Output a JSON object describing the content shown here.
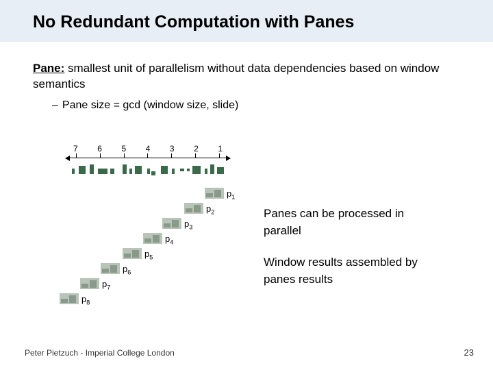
{
  "title": "No Redundant Computation with Panes",
  "definition": {
    "term": "Pane:",
    "text": " smallest unit of parallelism without data dependencies based on window semantics"
  },
  "sub_point": "Pane size = gcd (window size, slide)",
  "timeline_ticks": [
    "7",
    "6",
    "5",
    "4",
    "3",
    "2",
    "1"
  ],
  "panes": [
    {
      "label": "p",
      "sub": "1"
    },
    {
      "label": "p",
      "sub": "2"
    },
    {
      "label": "p",
      "sub": "3"
    },
    {
      "label": "p",
      "sub": "4"
    },
    {
      "label": "p",
      "sub": "5"
    },
    {
      "label": "p",
      "sub": "6"
    },
    {
      "label": "p",
      "sub": "7"
    },
    {
      "label": "p",
      "sub": "8"
    }
  ],
  "notes": {
    "line1": "Panes can be processed in parallel",
    "line2": "Window results assembled by panes results"
  },
  "footer": "Peter Pietzuch - Imperial College London",
  "page_number": "23"
}
